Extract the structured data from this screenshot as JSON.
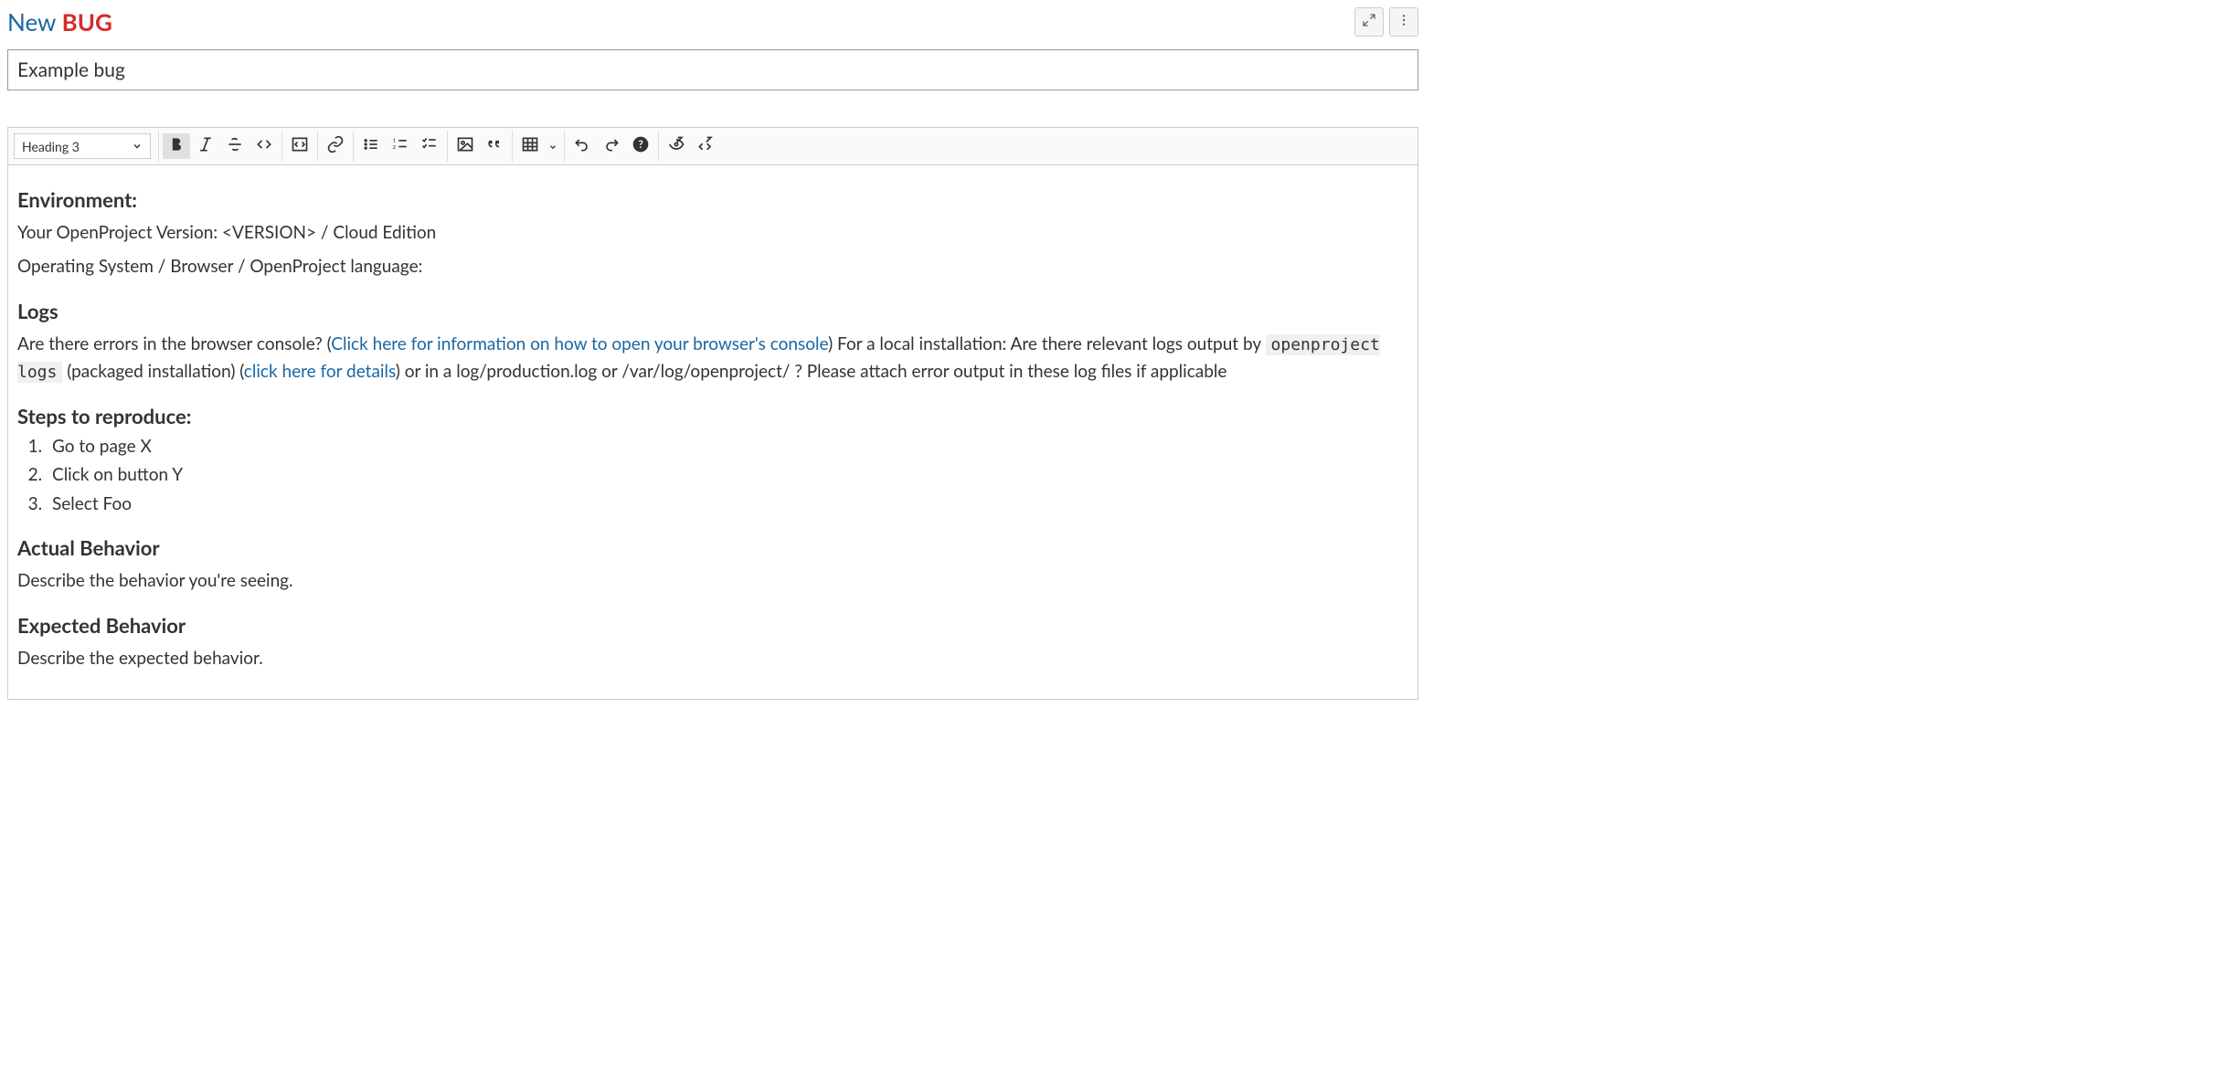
{
  "header": {
    "new_label": "New",
    "type_label": "BUG"
  },
  "subject_value": "Example bug",
  "toolbar": {
    "heading_dropdown": "Heading 3"
  },
  "content": {
    "env_heading": "Environment:",
    "env_line1": "Your OpenProject Version: <VERSION> / Cloud Edition",
    "env_line2": "Operating System / Browser / OpenProject language:",
    "logs_heading": "Logs",
    "logs_p_pre": "Are there errors in the browser console? (",
    "logs_link1": "Click here for information on how to open your browser's console",
    "logs_p_mid1": ") For a local installation: Are there relevant logs output by ",
    "logs_code": "openproject logs",
    "logs_p_mid2": " (packaged installation) (",
    "logs_link2": "click here for details",
    "logs_p_after": ") or in a log/production.log or /var/log/openproject/ ? Please attach error output in these log files if applicable",
    "steps_heading": "Steps to reproduce:",
    "steps": [
      "Go to page X",
      "Click on button Y",
      "Select Foo"
    ],
    "actual_heading": "Actual Behavior",
    "actual_text": "Describe the behavior you're seeing.",
    "expected_heading": "Expected Behavior",
    "expected_text": "Describe the expected behavior."
  }
}
